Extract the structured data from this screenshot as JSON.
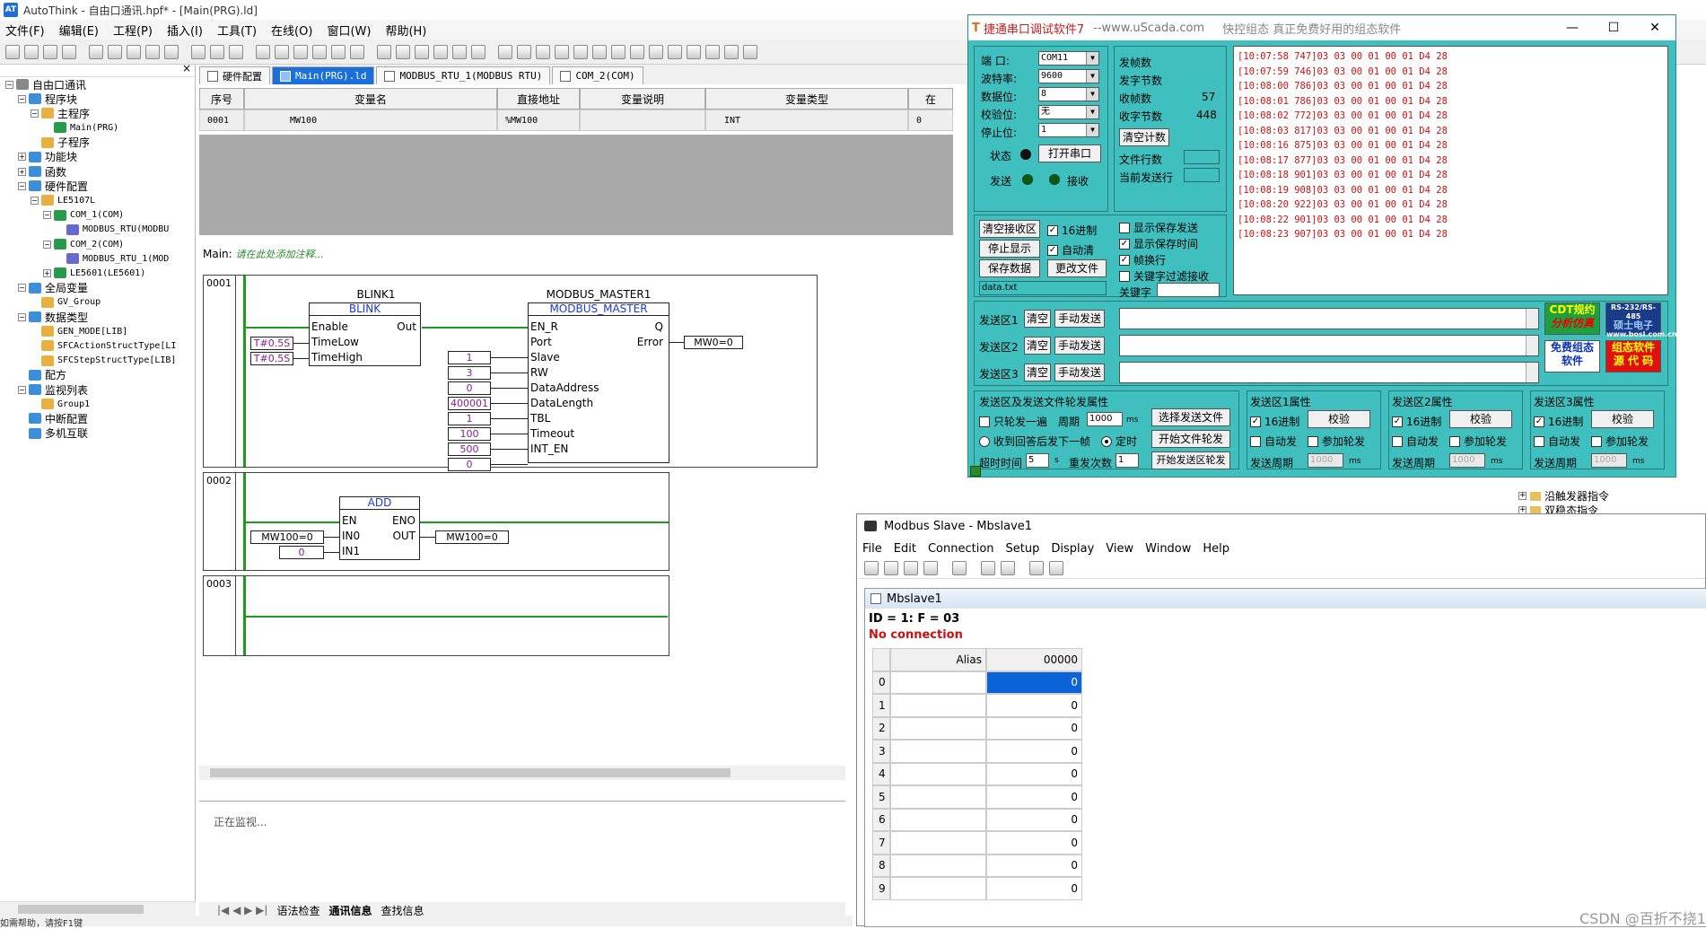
{
  "autothink": {
    "title": "AutoThink - 自由口通讯.hpf* - [Main(PRG).ld]",
    "menu": [
      "文件(F)",
      "编辑(E)",
      "工程(P)",
      "插入(I)",
      "工具(T)",
      "在线(O)",
      "窗口(W)",
      "帮助(H)"
    ],
    "tree": {
      "root": "自由口通讯",
      "items": [
        {
          "label": "程序块",
          "level": 1
        },
        {
          "label": "主程序",
          "level": 2
        },
        {
          "label": "Main(PRG)",
          "level": 3,
          "small": true
        },
        {
          "label": "子程序",
          "level": 2
        },
        {
          "label": "功能块",
          "level": 1
        },
        {
          "label": "函数",
          "level": 1
        },
        {
          "label": "硬件配置",
          "level": 1
        },
        {
          "label": "LE5107L",
          "level": 2,
          "small": true
        },
        {
          "label": "COM_1(COM)",
          "level": 3,
          "small": true
        },
        {
          "label": "MODBUS_RTU(MODBU",
          "level": 4,
          "small": true
        },
        {
          "label": "COM_2(COM)",
          "level": 3,
          "small": true
        },
        {
          "label": "MODBUS_RTU_1(MOD",
          "level": 4,
          "small": true
        },
        {
          "label": "LE5601(LE5601)",
          "level": 3,
          "small": true
        },
        {
          "label": "全局变量",
          "level": 1
        },
        {
          "label": "GV_Group",
          "level": 2,
          "small": true
        },
        {
          "label": "数据类型",
          "level": 1
        },
        {
          "label": "GEN_MODE[LIB]",
          "level": 2,
          "small": true
        },
        {
          "label": "SFCActionStructType[LI",
          "level": 2,
          "small": true
        },
        {
          "label": "SFCStepStructType[LIB]",
          "level": 2,
          "small": true
        },
        {
          "label": "配方",
          "level": 1
        },
        {
          "label": "监视列表",
          "level": 1
        },
        {
          "label": "Group1",
          "level": 2,
          "small": true
        },
        {
          "label": "中断配置",
          "level": 1
        },
        {
          "label": "多机互联",
          "level": 1
        }
      ]
    },
    "tabs": [
      "硬件配置",
      "Main(PRG).ld",
      "MODBUS_RTU_1(MODBUS RTU)",
      "COM_2(COM)"
    ],
    "var_table": {
      "headers": [
        "序号",
        "变量名",
        "直接地址",
        "变量说明",
        "变量类型",
        "在"
      ],
      "row": [
        "0001",
        "MW100",
        "%MW100",
        "",
        "INT",
        "0"
      ]
    },
    "main_label": "Main:",
    "main_comment": "请在此处添加注释...",
    "networks": {
      "n1": "0001",
      "n2": "0002",
      "n3": "0003"
    },
    "blink": {
      "instance": "BLINK1",
      "type": "BLINK",
      "pins_in": [
        "Enable",
        "TimeLow",
        "TimeHigh"
      ],
      "pin_out": "Out",
      "values": [
        "T#0.5S",
        "T#0.5S"
      ]
    },
    "mbm": {
      "instance": "MODBUS_MASTER1",
      "type": "MODBUS_MASTER",
      "pins_in": [
        "EN_R",
        "Port",
        "Slave",
        "RW",
        "DataAddress",
        "DataLength",
        "TBL",
        "Timeout",
        "INT_EN"
      ],
      "pins_out": [
        "Q",
        "Error"
      ],
      "values": [
        "1",
        "3",
        "0",
        "400001",
        "1",
        "100",
        "500",
        "0"
      ],
      "error_out": "MW0=0"
    },
    "add": {
      "type": "ADD",
      "pins_in": [
        "EN",
        "IN0",
        "IN1"
      ],
      "pins_out": [
        "ENO",
        "OUT"
      ],
      "in0": "MW100=0",
      "in1": "0",
      "out": "MW100=0"
    },
    "output_text": "正在监视...",
    "bottom_tabs": [
      "语法检查",
      "通讯信息",
      "查找信息"
    ],
    "status": "如需帮助，请按F1键"
  },
  "serial": {
    "title": "捷通串口调试软件7",
    "site": "--www.uScada.com",
    "slogan": "快控组态  真正免费好用的组态软件",
    "labels": {
      "port": "端  口:",
      "baud": "波特率:",
      "data": "数据位:",
      "parity": "校验位:",
      "stop": "停止位:",
      "state": "状态",
      "send": "发送",
      "recv": "接收"
    },
    "values": {
      "port": "COM11",
      "baud": "9600",
      "data": "8",
      "parity": "无",
      "stop": "1"
    },
    "open_btn": "打开串口",
    "stats": {
      "send_frames": "发帧数",
      "send_bytes": "发字节数",
      "recv_frames": "收帧数",
      "recv_frames_val": "57",
      "recv_bytes": "收字节数",
      "recv_bytes_val": "448",
      "clear": "清空计数",
      "file_rows": "文件行数",
      "cur_row": "当前发送行"
    },
    "rx": {
      "clear": "清空接收区",
      "hex": "16进制",
      "stop": "停止显示",
      "autoclear": "自动清",
      "save": "保存数据",
      "change": "更改文件",
      "file": "data.txt",
      "show_send": "显示保存发送",
      "show_time": "显示保存时间",
      "frame_wrap": "帧换行",
      "kw_filter": "关键字过滤接收",
      "keyword": "关键字"
    },
    "log": [
      "[10:07:58 747]03 03 00 01 00 01 D4 28",
      "[10:07:59 746]03 03 00 01 00 01 D4 28",
      "[10:08:00 786]03 03 00 01 00 01 D4 28",
      "[10:08:01 786]03 03 00 01 00 01 D4 28",
      "[10:08:02 772]03 03 00 01 00 01 D4 28",
      "[10:08:03 817]03 03 00 01 00 01 D4 28",
      "[10:08:16 875]03 03 00 01 00 01 D4 28",
      "[10:08:17 877]03 03 00 01 00 01 D4 28",
      "[10:08:18 901]03 03 00 01 00 01 D4 28",
      "[10:08:19 908]03 03 00 01 00 01 D4 28",
      "[10:08:20 922]03 03 00 01 00 01 D4 28",
      "[10:08:22 901]03 03 00 01 00 01 D4 28",
      "[10:08:23 907]03 03 00 01 00 01 D4 28"
    ],
    "send_areas": [
      {
        "label": "发送区1",
        "clear": "清空",
        "manual": "手动发送"
      },
      {
        "label": "发送区2",
        "clear": "清空",
        "manual": "手动发送"
      },
      {
        "label": "发送区3",
        "clear": "清空",
        "manual": "手动发送"
      }
    ],
    "badges": {
      "cdt1": "CDT规约",
      "cdt2": "分析仿真",
      "rs": "RS-232/RS-485",
      "bs": "硕士电子",
      "bsurl": "www.bosl.com.cn",
      "free1": "免费组态",
      "free2": "软件",
      "src1": "组态软件",
      "src2": "源 代 码"
    },
    "poll": {
      "title": "发送区及发送文件轮发属性",
      "once": "只轮发一遍",
      "period": "周期",
      "period_val": "1000",
      "ms": "ms",
      "select_file": "选择发送文件",
      "wait_reply": "收到回答后发下一帧",
      "timed": "定时",
      "start_file": "开始文件轮发",
      "timeout": "超时时间",
      "timeout_val": "5",
      "s": "s",
      "retry": "重发次数",
      "retry_val": "1",
      "start_area": "开始发送区轮发"
    },
    "props": [
      {
        "title": "发送区1属性",
        "hex": "16进制",
        "check": "校验",
        "auto": "自动发",
        "join": "参加轮发",
        "period": "发送周期",
        "val": "1000",
        "ms": "ms"
      },
      {
        "title": "发送区2属性",
        "hex": "16进制",
        "check": "校验",
        "auto": "自动发",
        "join": "参加轮发",
        "period": "发送周期",
        "val": "1000",
        "ms": "ms"
      },
      {
        "title": "发送区3属性",
        "hex": "16进制",
        "check": "校验",
        "auto": "自动发",
        "join": "参加轮发",
        "period": "发送周期",
        "val": "1000",
        "ms": "ms"
      }
    ]
  },
  "behind": {
    "a": "沿触发器指令",
    "b": "双稳态指令"
  },
  "modbus": {
    "title": "Modbus Slave - Mbslave1",
    "menu": [
      "File",
      "Edit",
      "Connection",
      "Setup",
      "Display",
      "View",
      "Window",
      "Help"
    ],
    "child_title": "Mbslave1",
    "id_line": "ID = 1: F = 03",
    "conn": "No connection",
    "grid_headers": [
      "Alias",
      "00000"
    ],
    "rows": [
      {
        "n": "0",
        "v": "0"
      },
      {
        "n": "1",
        "v": "0"
      },
      {
        "n": "2",
        "v": "0"
      },
      {
        "n": "3",
        "v": "0"
      },
      {
        "n": "4",
        "v": "0"
      },
      {
        "n": "5",
        "v": "0"
      },
      {
        "n": "6",
        "v": "0"
      },
      {
        "n": "7",
        "v": "0"
      },
      {
        "n": "8",
        "v": "0"
      },
      {
        "n": "9",
        "v": "0"
      }
    ]
  },
  "watermark": "CSDN @百折不挠1"
}
